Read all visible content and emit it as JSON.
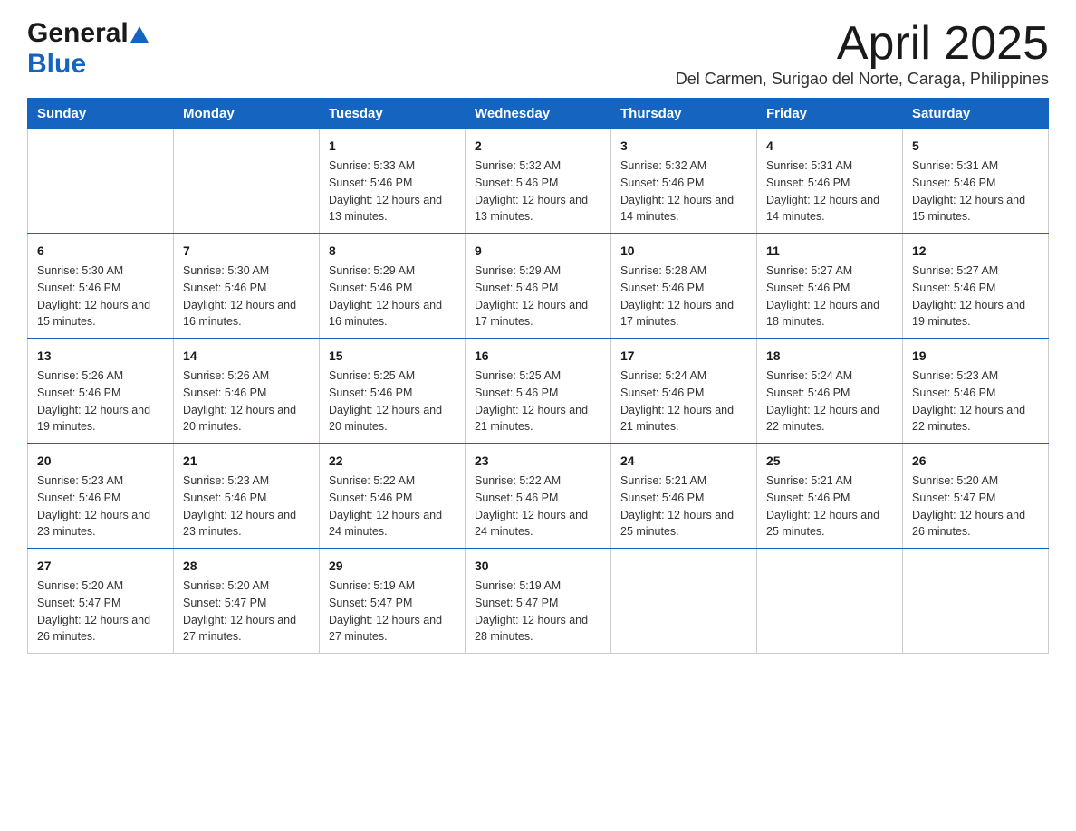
{
  "logo": {
    "line1": "General",
    "arrow": "▲",
    "line2": "Blue"
  },
  "title": {
    "month_year": "April 2025",
    "location": "Del Carmen, Surigao del Norte, Caraga, Philippines"
  },
  "days_of_week": [
    "Sunday",
    "Monday",
    "Tuesday",
    "Wednesday",
    "Thursday",
    "Friday",
    "Saturday"
  ],
  "weeks": [
    [
      {
        "num": "",
        "sunrise": "",
        "sunset": "",
        "daylight": ""
      },
      {
        "num": "",
        "sunrise": "",
        "sunset": "",
        "daylight": ""
      },
      {
        "num": "1",
        "sunrise": "Sunrise: 5:33 AM",
        "sunset": "Sunset: 5:46 PM",
        "daylight": "Daylight: 12 hours and 13 minutes."
      },
      {
        "num": "2",
        "sunrise": "Sunrise: 5:32 AM",
        "sunset": "Sunset: 5:46 PM",
        "daylight": "Daylight: 12 hours and 13 minutes."
      },
      {
        "num": "3",
        "sunrise": "Sunrise: 5:32 AM",
        "sunset": "Sunset: 5:46 PM",
        "daylight": "Daylight: 12 hours and 14 minutes."
      },
      {
        "num": "4",
        "sunrise": "Sunrise: 5:31 AM",
        "sunset": "Sunset: 5:46 PM",
        "daylight": "Daylight: 12 hours and 14 minutes."
      },
      {
        "num": "5",
        "sunrise": "Sunrise: 5:31 AM",
        "sunset": "Sunset: 5:46 PM",
        "daylight": "Daylight: 12 hours and 15 minutes."
      }
    ],
    [
      {
        "num": "6",
        "sunrise": "Sunrise: 5:30 AM",
        "sunset": "Sunset: 5:46 PM",
        "daylight": "Daylight: 12 hours and 15 minutes."
      },
      {
        "num": "7",
        "sunrise": "Sunrise: 5:30 AM",
        "sunset": "Sunset: 5:46 PM",
        "daylight": "Daylight: 12 hours and 16 minutes."
      },
      {
        "num": "8",
        "sunrise": "Sunrise: 5:29 AM",
        "sunset": "Sunset: 5:46 PM",
        "daylight": "Daylight: 12 hours and 16 minutes."
      },
      {
        "num": "9",
        "sunrise": "Sunrise: 5:29 AM",
        "sunset": "Sunset: 5:46 PM",
        "daylight": "Daylight: 12 hours and 17 minutes."
      },
      {
        "num": "10",
        "sunrise": "Sunrise: 5:28 AM",
        "sunset": "Sunset: 5:46 PM",
        "daylight": "Daylight: 12 hours and 17 minutes."
      },
      {
        "num": "11",
        "sunrise": "Sunrise: 5:27 AM",
        "sunset": "Sunset: 5:46 PM",
        "daylight": "Daylight: 12 hours and 18 minutes."
      },
      {
        "num": "12",
        "sunrise": "Sunrise: 5:27 AM",
        "sunset": "Sunset: 5:46 PM",
        "daylight": "Daylight: 12 hours and 19 minutes."
      }
    ],
    [
      {
        "num": "13",
        "sunrise": "Sunrise: 5:26 AM",
        "sunset": "Sunset: 5:46 PM",
        "daylight": "Daylight: 12 hours and 19 minutes."
      },
      {
        "num": "14",
        "sunrise": "Sunrise: 5:26 AM",
        "sunset": "Sunset: 5:46 PM",
        "daylight": "Daylight: 12 hours and 20 minutes."
      },
      {
        "num": "15",
        "sunrise": "Sunrise: 5:25 AM",
        "sunset": "Sunset: 5:46 PM",
        "daylight": "Daylight: 12 hours and 20 minutes."
      },
      {
        "num": "16",
        "sunrise": "Sunrise: 5:25 AM",
        "sunset": "Sunset: 5:46 PM",
        "daylight": "Daylight: 12 hours and 21 minutes."
      },
      {
        "num": "17",
        "sunrise": "Sunrise: 5:24 AM",
        "sunset": "Sunset: 5:46 PM",
        "daylight": "Daylight: 12 hours and 21 minutes."
      },
      {
        "num": "18",
        "sunrise": "Sunrise: 5:24 AM",
        "sunset": "Sunset: 5:46 PM",
        "daylight": "Daylight: 12 hours and 22 minutes."
      },
      {
        "num": "19",
        "sunrise": "Sunrise: 5:23 AM",
        "sunset": "Sunset: 5:46 PM",
        "daylight": "Daylight: 12 hours and 22 minutes."
      }
    ],
    [
      {
        "num": "20",
        "sunrise": "Sunrise: 5:23 AM",
        "sunset": "Sunset: 5:46 PM",
        "daylight": "Daylight: 12 hours and 23 minutes."
      },
      {
        "num": "21",
        "sunrise": "Sunrise: 5:23 AM",
        "sunset": "Sunset: 5:46 PM",
        "daylight": "Daylight: 12 hours and 23 minutes."
      },
      {
        "num": "22",
        "sunrise": "Sunrise: 5:22 AM",
        "sunset": "Sunset: 5:46 PM",
        "daylight": "Daylight: 12 hours and 24 minutes."
      },
      {
        "num": "23",
        "sunrise": "Sunrise: 5:22 AM",
        "sunset": "Sunset: 5:46 PM",
        "daylight": "Daylight: 12 hours and 24 minutes."
      },
      {
        "num": "24",
        "sunrise": "Sunrise: 5:21 AM",
        "sunset": "Sunset: 5:46 PM",
        "daylight": "Daylight: 12 hours and 25 minutes."
      },
      {
        "num": "25",
        "sunrise": "Sunrise: 5:21 AM",
        "sunset": "Sunset: 5:46 PM",
        "daylight": "Daylight: 12 hours and 25 minutes."
      },
      {
        "num": "26",
        "sunrise": "Sunrise: 5:20 AM",
        "sunset": "Sunset: 5:47 PM",
        "daylight": "Daylight: 12 hours and 26 minutes."
      }
    ],
    [
      {
        "num": "27",
        "sunrise": "Sunrise: 5:20 AM",
        "sunset": "Sunset: 5:47 PM",
        "daylight": "Daylight: 12 hours and 26 minutes."
      },
      {
        "num": "28",
        "sunrise": "Sunrise: 5:20 AM",
        "sunset": "Sunset: 5:47 PM",
        "daylight": "Daylight: 12 hours and 27 minutes."
      },
      {
        "num": "29",
        "sunrise": "Sunrise: 5:19 AM",
        "sunset": "Sunset: 5:47 PM",
        "daylight": "Daylight: 12 hours and 27 minutes."
      },
      {
        "num": "30",
        "sunrise": "Sunrise: 5:19 AM",
        "sunset": "Sunset: 5:47 PM",
        "daylight": "Daylight: 12 hours and 28 minutes."
      },
      {
        "num": "",
        "sunrise": "",
        "sunset": "",
        "daylight": ""
      },
      {
        "num": "",
        "sunrise": "",
        "sunset": "",
        "daylight": ""
      },
      {
        "num": "",
        "sunrise": "",
        "sunset": "",
        "daylight": ""
      }
    ]
  ]
}
